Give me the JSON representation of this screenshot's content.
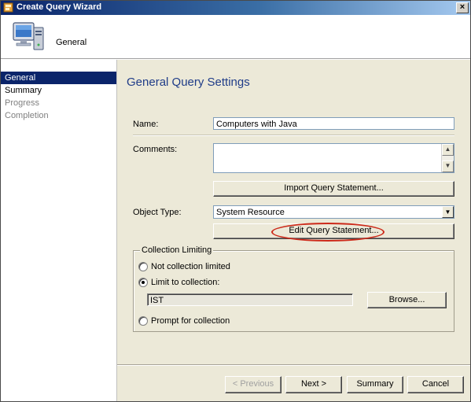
{
  "window": {
    "title": "Create Query Wizard",
    "close_glyph": "×"
  },
  "header": {
    "title": "General",
    "icon": "computer-icon"
  },
  "nav": {
    "items": [
      {
        "label": "General",
        "state": "active"
      },
      {
        "label": "Summary",
        "state": "normal"
      },
      {
        "label": "Progress",
        "state": "disabled"
      },
      {
        "label": "Completion",
        "state": "disabled"
      }
    ]
  },
  "main": {
    "title": "General Query Settings",
    "name_label": "Name:",
    "name_value": "Computers with Java",
    "comments_label": "Comments:",
    "comments_value": "",
    "import_button": "Import Query Statement...",
    "object_type_label": "Object Type:",
    "object_type_value": "System Resource",
    "edit_button": "Edit Query Statement...",
    "collection": {
      "legend": "Collection Limiting",
      "opt_not_limited": "Not collection limited",
      "opt_limit": "Limit to collection:",
      "collection_value": "IST",
      "browse_button": "Browse...",
      "opt_prompt": "Prompt for collection",
      "selected": "Limit to collection:"
    }
  },
  "footer": {
    "previous": "< Previous",
    "next": "Next >",
    "summary": "Summary",
    "cancel": "Cancel"
  },
  "colors": {
    "title_gradient_start": "#0a246a",
    "panel_bg": "#ece9d8",
    "heading_blue": "#1f3c88",
    "highlight_red": "#cc2a1a"
  }
}
